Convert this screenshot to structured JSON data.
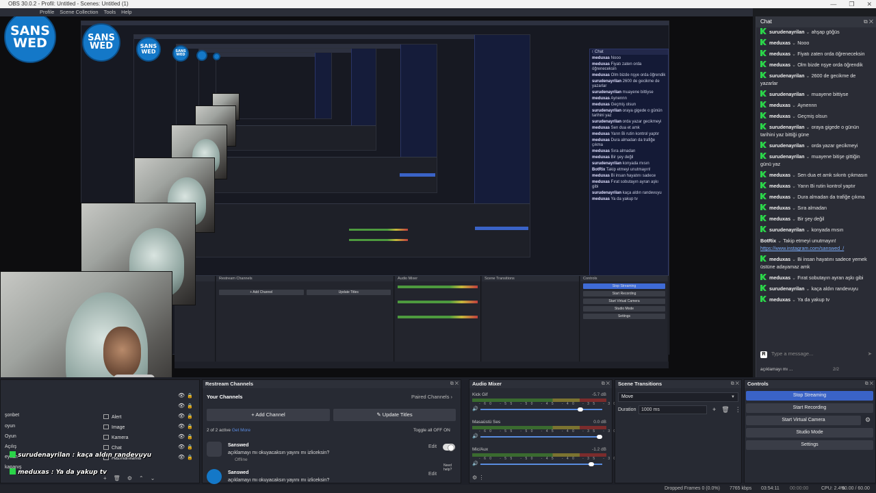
{
  "titlebar": {
    "title": "OBS 30.0.2 - Profil: Untitled - Scenes: Untitled (1)",
    "controls": [
      "—",
      "❐",
      "✕"
    ]
  },
  "menubar": {
    "items": [
      "Profile",
      "Scene Collection",
      "Tools",
      "Help"
    ]
  },
  "logo": {
    "line1": "SANS",
    "line2": "WED"
  },
  "chat": {
    "title": "Chat",
    "messages": [
      {
        "user": "surudenayrilan",
        "text": "ahşap göğüs"
      },
      {
        "user": "meduxas",
        "text": "Nooo"
      },
      {
        "user": "meduxas",
        "text": "Fiyatı zaten orda öğreneceksin"
      },
      {
        "user": "meduxas",
        "text": "Olm bizde nşye orda öğrendik"
      },
      {
        "user": "surudenayrilan",
        "text": "2600 de gecikme de yazarlar"
      },
      {
        "user": "surudenayrilan",
        "text": "muayene bittiyse"
      },
      {
        "user": "meduxas",
        "text": "Aynennn"
      },
      {
        "user": "meduxas",
        "text": "Geçmiş olsun"
      },
      {
        "user": "surudenayrilan",
        "text": "oraya gigede o günün tarihini yaz bittiği güne"
      },
      {
        "user": "surudenayrilan",
        "text": "orda yazar gecikmeyi"
      },
      {
        "user": "surudenayrilan",
        "text": "muayene bitişe gittiğin günü yaz"
      },
      {
        "user": "meduxas",
        "text": "Sen dua et amk sıkıntı çıkmasın"
      },
      {
        "user": "meduxas",
        "text": "Yarın Bi rutin kontrol yaptır"
      },
      {
        "user": "meduxas",
        "text": "Dura almadan da trafiğe çıkma"
      },
      {
        "user": "meduxas",
        "text": "Sıra almadan"
      },
      {
        "user": "meduxas",
        "text": "Bir şey değil"
      },
      {
        "user": "surudenayrilan",
        "text": "konyada mısın"
      },
      {
        "user": "BotRix",
        "text": "Takip etmeyi unutmayın!",
        "link": "https://www.instagram.com/sanswed_/",
        "nokick": true
      },
      {
        "user": "meduxas",
        "text": "Bi insan hayatını sadece yemek üstüne adayamaz amk"
      },
      {
        "user": "meduxas",
        "text": "Fırat sobutayın ayran aşkı gibi"
      },
      {
        "user": "surudenayrilan",
        "text": "kaça aldın randevuyu"
      },
      {
        "user": "meduxas",
        "text": "Ya da yakup tv"
      }
    ],
    "input_placeholder": "Type a message...",
    "input_badge": "R",
    "footer_text": "açıklamayı mı ...",
    "footer_page": "2/2"
  },
  "overlay": {
    "line1": "surudenayrilan : kaça aldın randevuyu",
    "line2": "meduxas : Ya da yakup tv"
  },
  "sources": {
    "scenes": [
      "şonbet",
      "oyun",
      "Oyun",
      "Açılış",
      "eyvah",
      "kapanış"
    ],
    "items": [
      "Alert",
      "Image",
      "Kamera",
      "Chat",
      "Hazırlanılama"
    ]
  },
  "restream": {
    "title": "Restream Channels",
    "your_channels": "Your Channels",
    "paired": "Paired Channels",
    "add_channel": "+ Add Channel",
    "update_titles": "Update Titles",
    "active": "2 of 2 active",
    "get_more": "Get More",
    "toggle_all": "Toggle all",
    "off": "OFF",
    "on": "ON",
    "channels": [
      {
        "name": "Sanswed",
        "desc": "açıklamayı mı okuyacaksın yayını mı izliceksin?",
        "status": "Offline",
        "edit": "Edit"
      },
      {
        "name": "Sanswed",
        "desc": "açıklamayı mı okuyacaksın yayını mı izliceksin?",
        "status": "",
        "edit": "Edit",
        "help": "Need help?"
      }
    ]
  },
  "audio": {
    "title": "Audio Mixer",
    "channels": [
      {
        "name": "Kick Gif",
        "db": "-5.7 dB",
        "level": 0.84
      },
      {
        "name": "Masaüstü Ses",
        "db": "0.0 dB",
        "level": 1.0
      },
      {
        "name": "Mic/Aux",
        "db": "-1.2 dB",
        "level": 0.93
      }
    ],
    "ticks": "-60 -55 -50 -45 -40 -35 -30 -25 -20 -15 -10 -5 0"
  },
  "transitions": {
    "title": "Scene Transitions",
    "selected": "Move",
    "duration_label": "Duration",
    "duration": "1000 ms"
  },
  "controls": {
    "title": "Controls",
    "buttons": [
      "Stop Streaming",
      "Start Recording",
      "Start Virtual Camera",
      "Studio Mode",
      "Settings"
    ]
  },
  "status": {
    "dropped": "Dropped Frames 0 (0.0%)",
    "kbps": "7765 kbps",
    "stream_time": "03:54:11",
    "rec_time": "00:00:00",
    "cpu": "CPU: 2.4%",
    "fps": "60.00 / 60.00 FPS"
  },
  "colors": {
    "accent": "#3a63c7",
    "kick_green": "#2bd449",
    "logo_blue": "#1478c8"
  }
}
